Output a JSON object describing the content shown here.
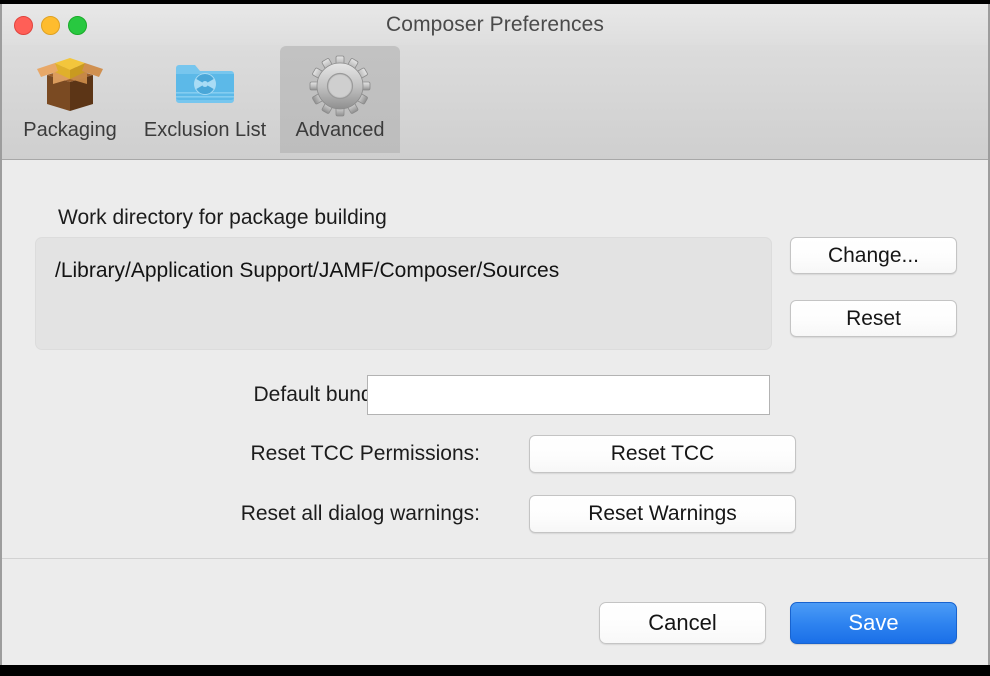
{
  "window": {
    "title": "Composer Preferences",
    "controls": [
      {
        "name": "close",
        "color": "#ff5f57"
      },
      {
        "name": "minimize",
        "color": "#febc2e"
      },
      {
        "name": "maximize",
        "color": "#28c840"
      }
    ]
  },
  "toolbar": {
    "tabs": [
      {
        "id": "packaging",
        "label": "Packaging",
        "icon": "open-box-icon",
        "selected": false
      },
      {
        "id": "exclusion-list",
        "label": "Exclusion List",
        "icon": "burn-folder-icon",
        "selected": false
      },
      {
        "id": "advanced",
        "label": "Advanced",
        "icon": "gear-icon",
        "selected": true
      }
    ]
  },
  "main": {
    "work_directory": {
      "heading": "Work directory for package building",
      "path": "/Library/Application Support/JAMF/Composer/Sources",
      "change_label": "Change...",
      "reset_label": "Reset"
    },
    "bundle_identifier": {
      "label": "Default bundle identifier:",
      "value": "",
      "placeholder": ""
    },
    "tcc": {
      "label": "Reset TCC Permissions:",
      "button_label": "Reset TCC"
    },
    "warnings": {
      "label": "Reset all dialog warnings:",
      "button_label": "Reset Warnings"
    }
  },
  "footer": {
    "cancel_label": "Cancel",
    "save_label": "Save",
    "save_accent": "#1a6fe8"
  }
}
